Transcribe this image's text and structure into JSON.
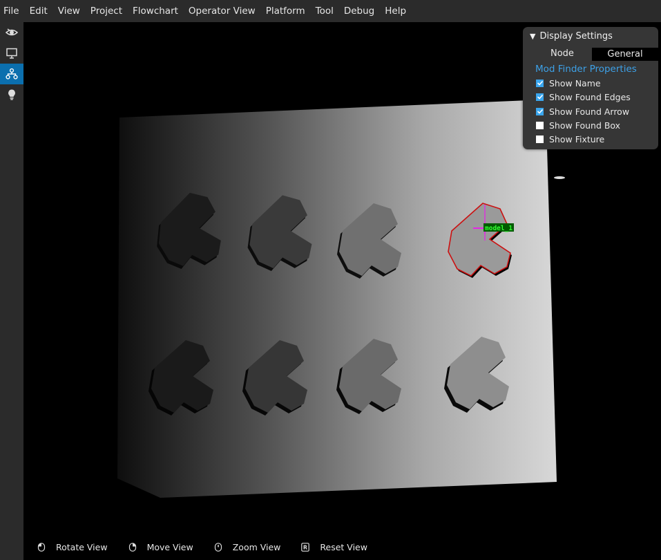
{
  "menubar": {
    "items": [
      "File",
      "Edit",
      "View",
      "Project",
      "Flowchart",
      "Operator View",
      "Platform",
      "Tool",
      "Debug",
      "Help"
    ]
  },
  "lefttool": {
    "items": [
      {
        "icon": "camera-eye-icon",
        "active": false
      },
      {
        "icon": "monitor-icon",
        "active": false
      },
      {
        "icon": "flowchart-icon",
        "active": true
      },
      {
        "icon": "lightbulb-icon",
        "active": false
      }
    ]
  },
  "viewport": {
    "found_label": "model_1"
  },
  "display_settings": {
    "title": "Display Settings",
    "node_label": "Node",
    "node_value": "General",
    "section_title": "Mod Finder Properties",
    "options": [
      {
        "label": "Show Name",
        "checked": true
      },
      {
        "label": "Show Found Edges",
        "checked": true
      },
      {
        "label": "Show Found Arrow",
        "checked": true
      },
      {
        "label": "Show Found Box",
        "checked": false
      },
      {
        "label": "Show Fixture",
        "checked": false
      }
    ]
  },
  "helpbar": {
    "items": [
      {
        "icon": "mouse-left-icon",
        "label": "Rotate View"
      },
      {
        "icon": "mouse-right-icon",
        "label": "Move View"
      },
      {
        "icon": "mouse-wheel-icon",
        "label": "Zoom View"
      },
      {
        "icon": "reset-key-icon",
        "label": "Reset View"
      }
    ]
  },
  "colors": {
    "accent": "#0b6fae",
    "checkbox": "#3aa6ee",
    "section_title": "#3da0e6",
    "found_edge": "#cc1010",
    "found_label_bg": "#005a00",
    "found_label_text": "#33ff33",
    "fixture_cross": "#ff00ff"
  }
}
